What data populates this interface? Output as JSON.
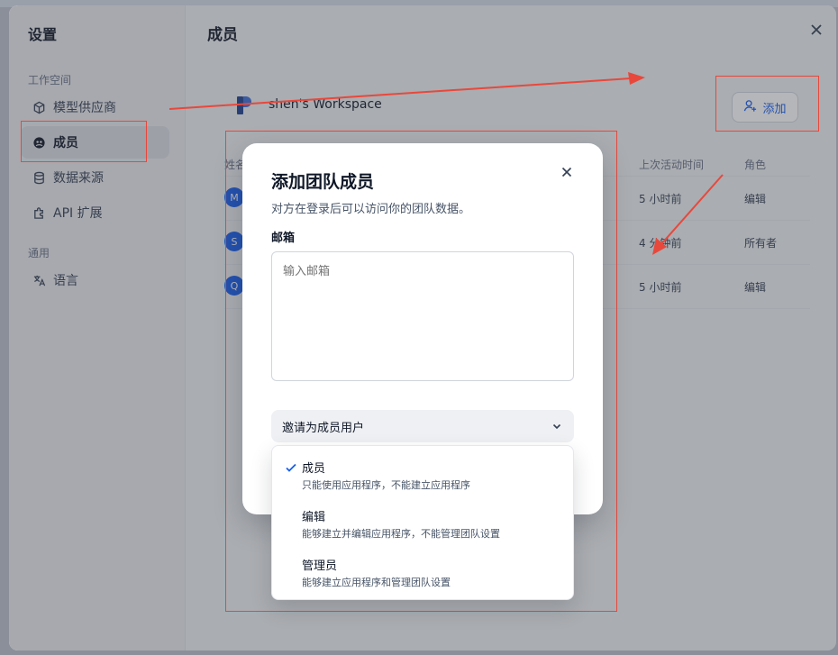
{
  "window": {
    "title": "设置",
    "close_icon": "close-icon"
  },
  "sidebar": {
    "group_workspace": "工作空间",
    "group_general": "通用",
    "items": [
      {
        "label": "模型供应商",
        "icon": "cube-icon"
      },
      {
        "label": "成员",
        "icon": "members-icon",
        "active": true
      },
      {
        "label": "数据来源",
        "icon": "database-icon"
      },
      {
        "label": "API 扩展",
        "icon": "puzzle-icon"
      },
      {
        "label": "语言",
        "icon": "translate-icon"
      }
    ]
  },
  "main": {
    "title": "成员",
    "workspace_name": "shen's Workspace",
    "add_button": "添加",
    "table": {
      "columns": {
        "name": "姓名",
        "last_active": "上次活动时间",
        "role": "角色"
      },
      "rows": [
        {
          "avatar": "M",
          "last_active": "5 小时前",
          "role": "编辑"
        },
        {
          "avatar": "S",
          "last_active": "4 分钟前",
          "role": "所有者"
        },
        {
          "avatar": "Q",
          "last_active": "5 小时前",
          "role": "编辑"
        }
      ]
    }
  },
  "modal": {
    "title": "添加团队成员",
    "description": "对方在登录后可以访问你的团队数据。",
    "email_label": "邮箱",
    "email_placeholder": "输入邮箱",
    "role_select": "邀请为成员用户",
    "options": [
      {
        "name": "成员",
        "desc": "只能使用应用程序，不能建立应用程序",
        "selected": true
      },
      {
        "name": "编辑",
        "desc": "能够建立并编辑应用程序，不能管理团队设置",
        "selected": false
      },
      {
        "name": "管理员",
        "desc": "能够建立应用程序和管理团队设置",
        "selected": false
      }
    ]
  },
  "colors": {
    "accent": "#155eef",
    "annotation_red": "#e8483c"
  }
}
